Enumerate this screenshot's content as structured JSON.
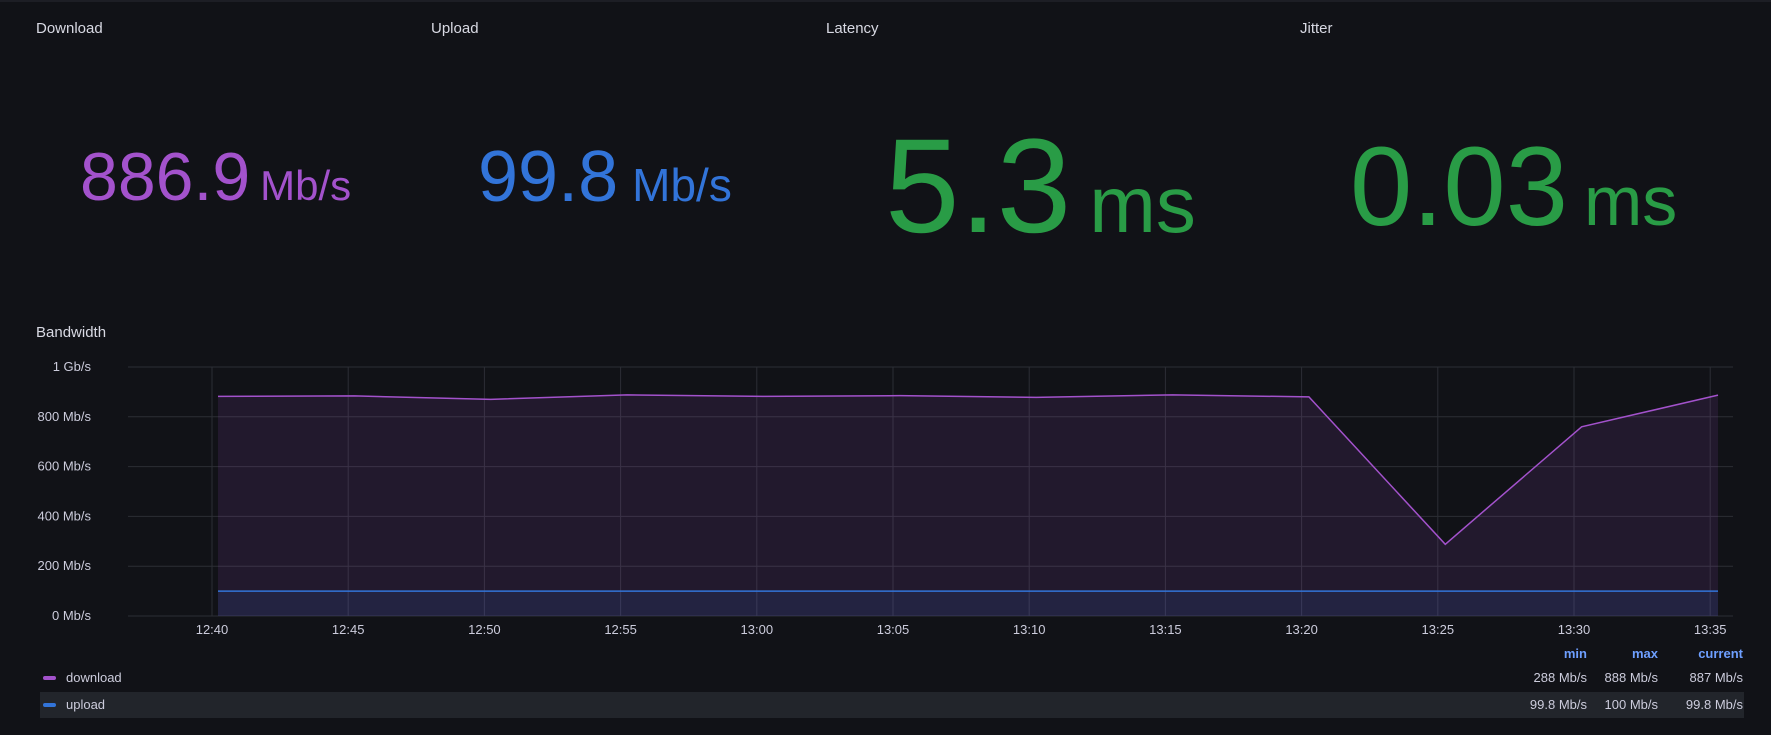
{
  "panels": {
    "download": {
      "title": "Download",
      "value": "886.9",
      "unit": "Mb/s",
      "color": "#a352cc"
    },
    "upload": {
      "title": "Upload",
      "value": "99.8",
      "unit": "Mb/s",
      "color": "#3274d9"
    },
    "latency": {
      "title": "Latency",
      "value": "5.3",
      "unit": "ms",
      "color": "#299c46"
    },
    "jitter": {
      "title": "Jitter",
      "value": "0.03",
      "unit": "ms",
      "color": "#299c46"
    }
  },
  "bandwidth": {
    "title": "Bandwidth",
    "legend_headers": {
      "min": "min",
      "max": "max",
      "current": "current"
    },
    "legend": [
      {
        "name": "download",
        "min": "288 Mb/s",
        "max": "888 Mb/s",
        "current": "887 Mb/s",
        "color": "#a352cc"
      },
      {
        "name": "upload",
        "min": "99.8 Mb/s",
        "max": "100 Mb/s",
        "current": "99.8 Mb/s",
        "color": "#3274d9"
      }
    ]
  },
  "chart_data": {
    "type": "area",
    "title": "Bandwidth",
    "y_ticks": [
      "0 Mb/s",
      "200 Mb/s",
      "400 Mb/s",
      "600 Mb/s",
      "800 Mb/s",
      "1 Gb/s"
    ],
    "ylim": [
      0,
      1000
    ],
    "x_ticks": [
      "12:40",
      "12:45",
      "12:50",
      "12:55",
      "13:00",
      "13:05",
      "13:10",
      "13:15",
      "13:20",
      "13:25",
      "13:30",
      "13:35"
    ],
    "x": [
      "12:40",
      "12:45",
      "12:50",
      "12:55",
      "13:00",
      "13:05",
      "13:10",
      "13:15",
      "13:20",
      "13:25",
      "13:30",
      "13:35"
    ],
    "series": [
      {
        "name": "download",
        "color": "#a352cc",
        "values": [
          882,
          884,
          870,
          888,
          882,
          885,
          878,
          888,
          880,
          288,
          760,
          887
        ]
      },
      {
        "name": "upload",
        "color": "#3274d9",
        "values": [
          99.8,
          100,
          99.8,
          100,
          99.8,
          100,
          99.8,
          100,
          99.8,
          99.8,
          100,
          99.8
        ]
      }
    ],
    "grid": true
  }
}
